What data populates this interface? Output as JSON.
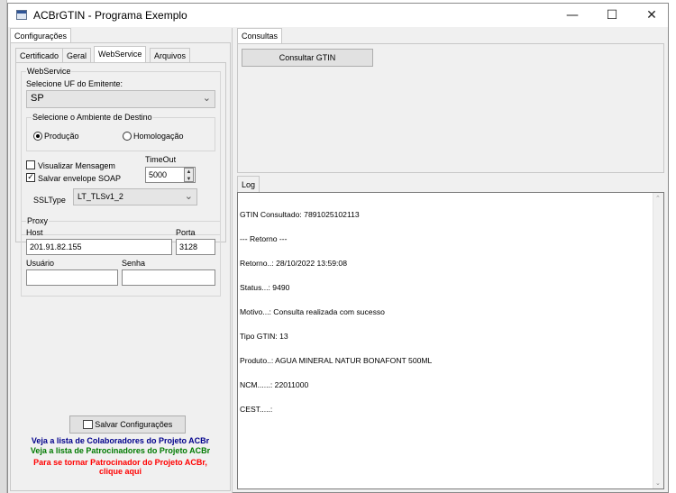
{
  "window": {
    "title": "ACBrGTIN - Programa Exemplo",
    "minimize": "—",
    "maximize": "☐",
    "close": "✕"
  },
  "left_panel": {
    "tab_label": "Configurações",
    "subtabs": [
      "Certificado",
      "Geral",
      "WebService",
      "Arquivos"
    ],
    "active_subtab": "WebService",
    "webservice": {
      "group_label": "WebService",
      "uf_label": "Selecione UF do Emitente:",
      "uf_value": "SP",
      "ambiente_label": "Selecione o Ambiente de Destino",
      "producao_label": "Produção",
      "homologacao_label": "Homologação",
      "producao_selected": true,
      "visualizar_label": "Visualizar Mensagem",
      "visualizar_checked": false,
      "salvar_envelope_label": "Salvar envelope SOAP",
      "salvar_envelope_checked": true,
      "timeout_label": "TimeOut",
      "timeout_value": "5000",
      "ssltype_label": "SSLType",
      "ssltype_value": "LT_TLSv1_2"
    },
    "proxy": {
      "group_label": "Proxy",
      "host_label": "Host",
      "host_value": "201.91.82.155",
      "porta_label": "Porta",
      "porta_value": "3128",
      "usuario_label": "Usuário",
      "usuario_value": "",
      "senha_label": "Senha",
      "senha_value": ""
    },
    "save_button": "Salvar Configurações",
    "links": {
      "colaboradores": "Veja a lista de Colaboradores do Projeto ACBr",
      "patrocinadores": "Veja a lista de Patrocinadores do Projeto ACBr",
      "patrocinador_line1": "Para se tornar Patrocinador do Projeto ACBr,",
      "patrocinador_line2": "clique aqui"
    },
    "colors": {
      "colaboradores": "#00008b",
      "patrocinadores": "#007a00",
      "patrocinador": "#ff0000"
    }
  },
  "right_panel": {
    "consultas_tab": "Consultas",
    "consultar_button": "Consultar GTIN",
    "log_tab": "Log",
    "log_lines": [
      "GTIN Consultado: 7891025102113",
      "--- Retorno ---",
      "Retorno..: 28/10/2022 13:59:08",
      "Status...: 9490",
      "Motivo...: Consulta realizada com sucesso",
      "Tipo GTIN: 13",
      "Produto..: AGUA MINERAL NATUR BONAFONT 500ML",
      "NCM......: 22011000",
      "CEST.....:"
    ]
  }
}
